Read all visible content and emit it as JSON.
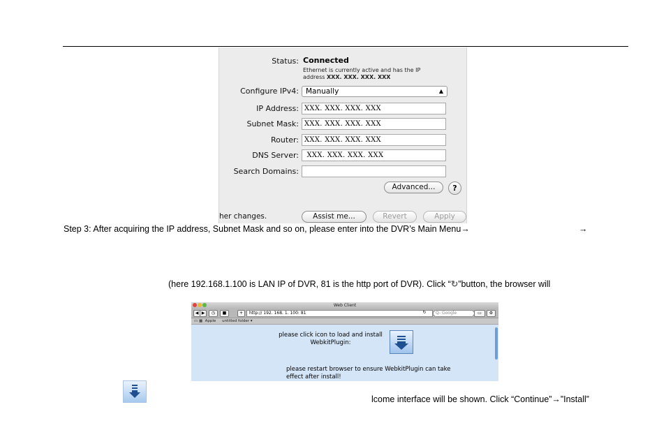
{
  "network_panel": {
    "status_label": "Status:",
    "status_value": "Connected",
    "status_desc_line1": "Ethernet is currently active and has the IP",
    "status_desc_line2_prefix": "address ",
    "status_desc_line2_addr": "XXX. XXX. XXX. XXX",
    "configure_label": "Configure IPv4:",
    "configure_value": "Manually",
    "ip_label": "IP Address:",
    "ip_value": "XXX. XXX. XXX. XXX",
    "subnet_label": "Subnet Mask:",
    "subnet_value": "XXX. XXX. XXX. XXX",
    "router_label": "Router:",
    "router_value": "XXX. XXX. XXX. XXX",
    "dns_label": "DNS Server:",
    "dns_value": " XXX. XXX. XXX. XXX",
    "search_label": "Search Domains:",
    "search_value": "",
    "advanced_button": "Advanced...",
    "help_button": "?",
    "partial_text": "her changes.",
    "assist_button": "Assist me...",
    "revert_button": "Revert",
    "apply_button": "Apply"
  },
  "text": {
    "step3": "Step 3: After acquiring the IP address, Subnet Mask and so on, please enter into the DVR’s Main Menu→",
    "arrow_only": "→",
    "line_here_prefix": "(here 192.168.1.100 is LAN IP of DVR, 81 is the http port of DVR). Click “",
    "refresh_glyph": "↻",
    "line_here_suffix": "”button, the browser will",
    "welcome_line": "lcome interface will be shown. Click “Continue”→”Install”"
  },
  "browser": {
    "title": "Web Client",
    "url": "http:// 192. 168. 1. 100: 81",
    "search_placeholder": "Q- Google",
    "bookmark_apple": "Apple",
    "bookmark_folder": "untitled folder ▾",
    "message_install": "please click icon to load and install WebkitPlugin:",
    "message_restart_line1": "please restart browser to ensure WebkitPlugin can take",
    "message_restart_line2": "effect after install!",
    "traffic_colors": [
      "#e0443b",
      "#e8b932",
      "#5bb843"
    ]
  },
  "icons": {
    "download": "download-arrow-icon",
    "refresh": "refresh-icon",
    "help": "question-icon"
  }
}
